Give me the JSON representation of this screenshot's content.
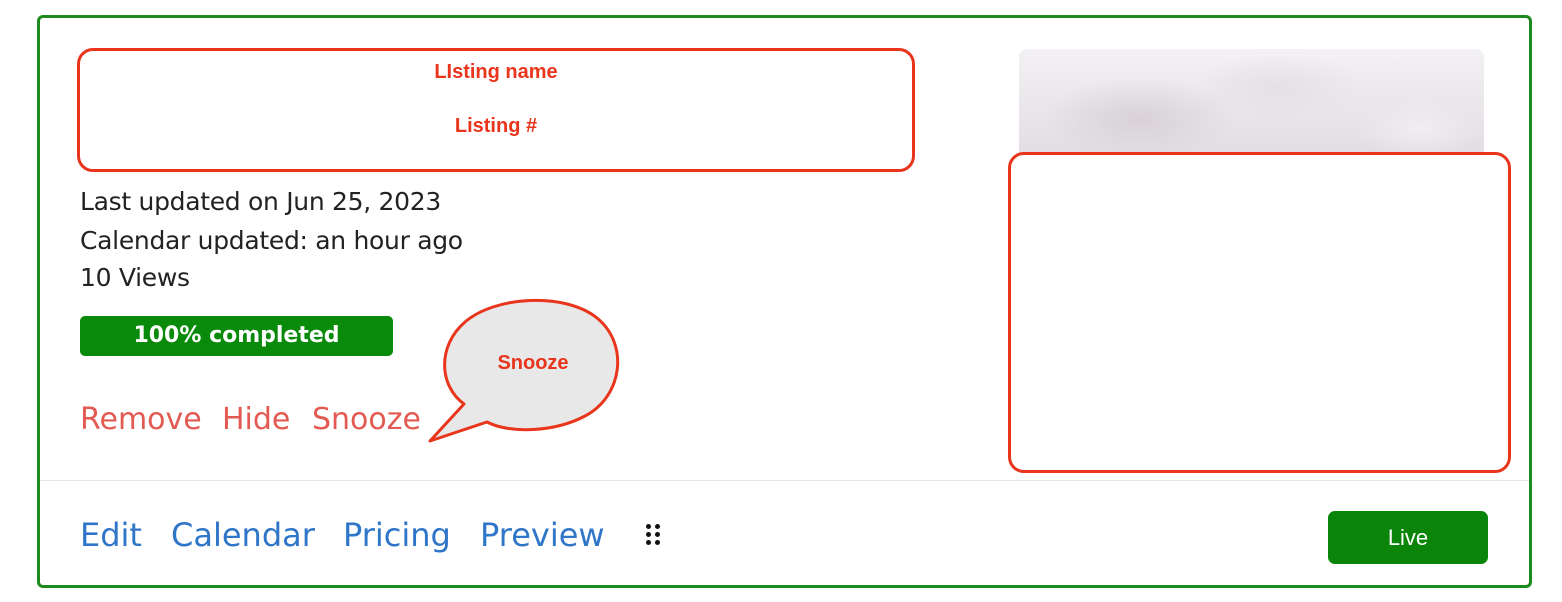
{
  "annotations": {
    "listing_name": "LIsting name",
    "listing_number": "Listing #",
    "snooze_callout": "Snooze"
  },
  "listing": {
    "last_updated": "Last updated on Jun 25, 2023",
    "calendar_updated": "Calendar updated: an hour ago",
    "views": "10 Views",
    "completion_percent": 100,
    "completion_label": "100% completed"
  },
  "actions": {
    "remove": "Remove",
    "hide": "Hide",
    "snooze": "Snooze"
  },
  "nav": {
    "edit": "Edit",
    "calendar": "Calendar",
    "pricing": "Pricing",
    "preview": "Preview",
    "more_icon": "drag-dots-icon"
  },
  "status_button": {
    "label": "Live"
  },
  "colors": {
    "card_border": "#1e8a1e",
    "annotation": "#e8351c",
    "action_link": "#e35a52",
    "nav_link": "#2f76c8",
    "status_green": "#0a850a"
  }
}
